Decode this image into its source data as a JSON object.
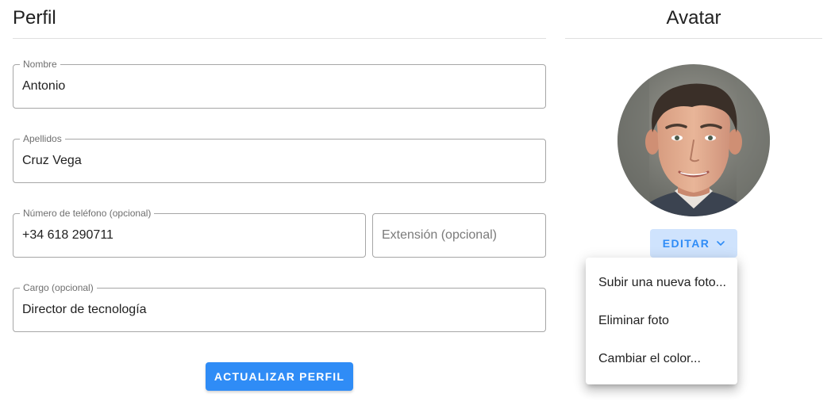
{
  "profile": {
    "title": "Perfil",
    "fields": {
      "first_name": {
        "label": "Nombre",
        "value": "Antonio"
      },
      "last_name": {
        "label": "Apellidos",
        "value": "Cruz Vega"
      },
      "phone": {
        "label": "Número de teléfono (opcional)",
        "value": "+34 618 290711"
      },
      "extension": {
        "placeholder": "Extensión (opcional)",
        "value": ""
      },
      "job_title": {
        "label": "Cargo (opcional)",
        "value": "Director de tecnología"
      }
    },
    "update_button": "ACTUALIZAR PERFIL"
  },
  "avatar": {
    "title": "Avatar",
    "edit_button": "EDITAR",
    "edit_icon": "chevron-down-icon",
    "menu": {
      "items": [
        {
          "label": "Subir una nueva foto..."
        },
        {
          "label": "Eliminar foto"
        },
        {
          "label": "Cambiar el color..."
        }
      ]
    }
  },
  "colors": {
    "primary": "#2f8cf6",
    "primary_light": "#cfe3fd",
    "divider": "#e0e0e0",
    "field_border": "#a6a6a6"
  }
}
